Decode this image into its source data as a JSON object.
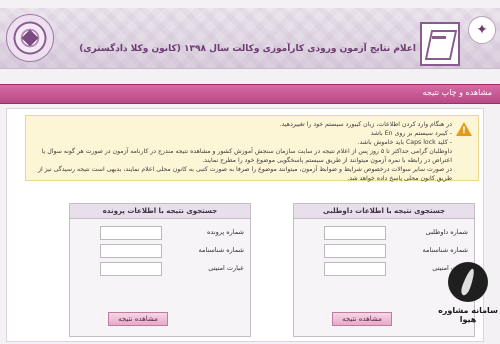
{
  "header": {
    "title": "اعلام نتایج آزمون ورودی کارآموزی وکالت سال ۱۳۹۸ (کانون وکلا دادگستری)"
  },
  "section": {
    "title": "مشاهده و چاپ نتیجه"
  },
  "warning": {
    "lines": [
      "در هنگام وارد کردن اطلاعات، زبان کیبورد سیستم خود را تغییردهید.",
      "- کیبرد سیستم بر روی En باشد",
      "- کلید Caps lock باید خاموش باشد.",
      "داوطلبان گرامی حداکثر تا ۵ روز پس از اعلام نتیجه در سایت سازمان سنجش آموزش کشور و مشاهده نتیجه مندرج در کارنامه آزمون در صورت هر گونه سوال یا",
      "اعتراض در رابطه با نمره آزمون میتوانند از طریق سیستم پاسخگویی موضوع خود را مطرح نمایند.",
      "در صورت سایر سوالات درخصوص شرایط و ضوابط آزمون، میتوانند موضوع را صرفا به صورت کتبی به کانون محلی اعلام نمایند، بدیهی است نتیجه رسیدگی نیز از",
      "طریق کانون محلی پاسخ داده خواهد شد."
    ]
  },
  "panel_right": {
    "title": "جستجوی نتیجه با اطلاعات داوطلبی",
    "fields": [
      {
        "label": "شماره داوطلبی",
        "value": ""
      },
      {
        "label": "شماره شناسنامه",
        "value": ""
      },
      {
        "label": "عبارت امنیتی",
        "value": ""
      }
    ],
    "button": "مشاهده نتیجه"
  },
  "panel_left": {
    "title": "جستجوی نتیجه با اطلاعات پرونده",
    "fields": [
      {
        "label": "شماره پرونده",
        "value": ""
      },
      {
        "label": "شماره شناسنامه",
        "value": ""
      },
      {
        "label": "عبارت امنیتی",
        "value": ""
      }
    ],
    "button": "مشاهده نتیجه"
  },
  "watermark": {
    "text": "سامانه مشاوره هیوا"
  },
  "colors": {
    "section_bar": "#c0508f",
    "header_text": "#6b3b70",
    "warning_bg": "#fdf6d6",
    "button_bg": "#e7a9c8"
  },
  "icons": {
    "warning": "warning-triangle-icon",
    "logo_left": "emblem-icon",
    "logo_right": "bar-association-logo-icon"
  }
}
